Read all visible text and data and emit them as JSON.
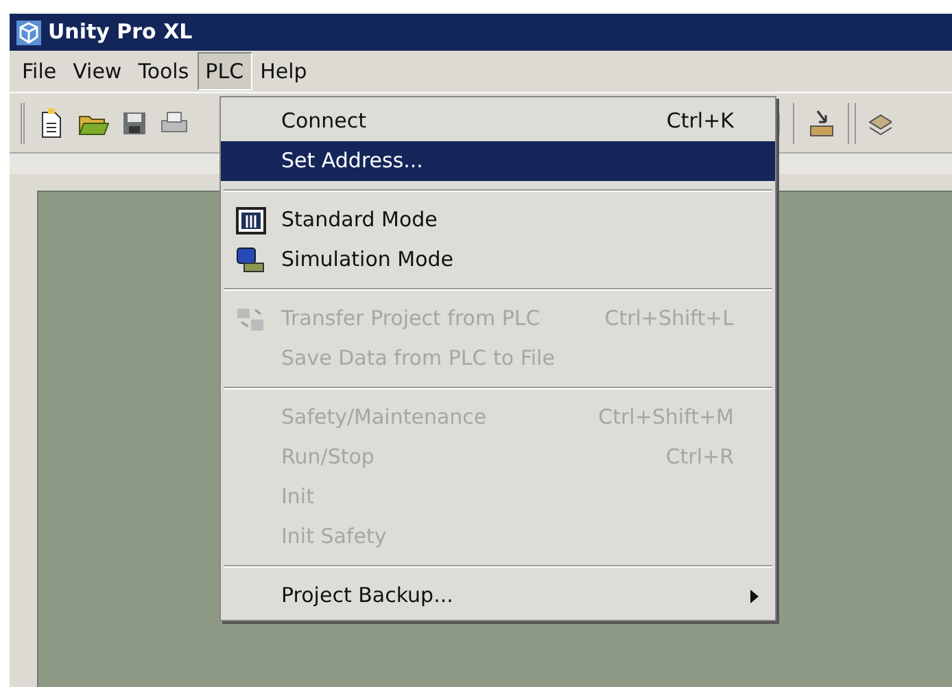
{
  "window": {
    "title": "Unity Pro XL"
  },
  "menu_bar": [
    {
      "label": "File",
      "selected": false
    },
    {
      "label": "View",
      "selected": false
    },
    {
      "label": "Tools",
      "selected": false
    },
    {
      "label": "PLC",
      "selected": true
    },
    {
      "label": "Help",
      "selected": false
    }
  ],
  "plc_menu": [
    {
      "kind": "item",
      "label": "Connect",
      "shortcut": "Ctrl+K",
      "disabled": false,
      "selected": false
    },
    {
      "kind": "item",
      "label": "Set Address...",
      "disabled": false,
      "selected": true
    },
    {
      "kind": "separator"
    },
    {
      "kind": "item",
      "label": "Standard Mode",
      "disabled": false,
      "selected": false
    },
    {
      "kind": "item",
      "label": "Simulation Mode",
      "disabled": false,
      "selected": false
    },
    {
      "kind": "separator"
    },
    {
      "kind": "item",
      "label": "Transfer Project from PLC",
      "shortcut": "Ctrl+Shift+L",
      "disabled": true,
      "selected": false
    },
    {
      "kind": "item",
      "label": "Save Data from PLC to File",
      "disabled": true,
      "selected": false
    },
    {
      "kind": "separator"
    },
    {
      "kind": "item",
      "label": "Safety/Maintenance",
      "shortcut": "Ctrl+Shift+M",
      "disabled": true,
      "selected": false
    },
    {
      "kind": "item",
      "label": "Run/Stop",
      "shortcut": "Ctrl+R",
      "disabled": true,
      "selected": false
    },
    {
      "kind": "item",
      "label": "Init",
      "disabled": true,
      "selected": false
    },
    {
      "kind": "item",
      "label": "Init Safety",
      "disabled": true,
      "selected": false
    },
    {
      "kind": "separator"
    },
    {
      "kind": "item",
      "label": "Project Backup...",
      "disabled": false,
      "selected": false,
      "submenu": true
    }
  ]
}
